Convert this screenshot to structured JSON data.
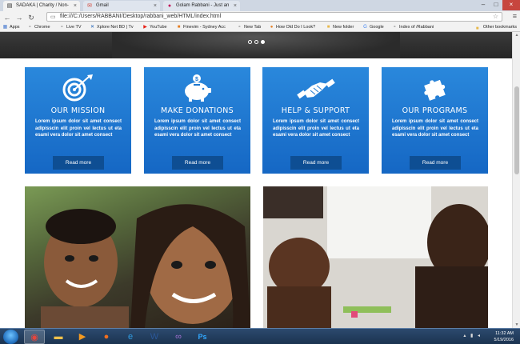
{
  "browser": {
    "tabs": [
      {
        "title": "SADAKA | Charity / Non-",
        "icon": "page-icon",
        "active": true
      },
      {
        "title": "Gmail",
        "icon": "gmail-icon",
        "active": false
      },
      {
        "title": "Golam Rabbani - Just an",
        "icon": "profile-icon",
        "active": false
      }
    ],
    "url": "file:///C:/Users/RABBANI/Desktop/rabbani_web/HTML/index.html",
    "bookmarks": [
      {
        "label": "Apps",
        "icon": "apps-icon"
      },
      {
        "label": "Chrome",
        "icon": "page-icon"
      },
      {
        "label": "Live TV",
        "icon": "page-icon"
      },
      {
        "label": "Xplore Net BD | Tv",
        "icon": "x-icon"
      },
      {
        "label": "YouTube",
        "icon": "youtube-icon"
      },
      {
        "label": "Finevim - Sydney Acc",
        "icon": "page-icon"
      },
      {
        "label": "New Tab",
        "icon": "page-icon"
      },
      {
        "label": "How Old Do I Look?",
        "icon": "page-icon"
      },
      {
        "label": "New folder",
        "icon": "folder-icon"
      },
      {
        "label": "Google",
        "icon": "google-icon"
      },
      {
        "label": "Index of /Rabbani",
        "icon": "page-icon"
      }
    ],
    "other_bookmarks": "Other bookmarks"
  },
  "page": {
    "slider_dots": 3,
    "active_dot": 2,
    "cards": [
      {
        "title": "OUR MISSION",
        "icon": "target-icon",
        "text": "Lorem ipsum dolor sit amet consect adipisscin elit proin vel lectus ut eta esami vera dolor sit amet consect",
        "button": "Read more"
      },
      {
        "title": "MAKE DONATIONS",
        "icon": "piggy-bank-icon",
        "text": "Lorem ipsum dolor sit amet consect adipisscin elit proin vel lectus ut eta esami vera dolor sit amet consect",
        "button": "Read more"
      },
      {
        "title": "HELP & SUPPORT",
        "icon": "handshake-icon",
        "text": "Lorem ipsum dolor sit amet consect adipisscin elit proin vel lectus ut eta esami vera dolor sit amet consect",
        "button": "Read more"
      },
      {
        "title": "OUR PROGRAMS",
        "icon": "puzzle-icon",
        "text": "Lorem ipsum dolor sit amet consect adipisscin elit proin vel lectus ut eta esami vera dolor sit amet consect",
        "button": "Read more"
      }
    ],
    "colors": {
      "card_blue": "#1f78d1",
      "button_blue": "#0e4e93"
    }
  },
  "taskbar": {
    "apps": [
      "chrome-icon",
      "explorer-folder-icon",
      "media-player-icon",
      "firefox-icon",
      "internet-explorer-icon",
      "word-icon",
      "visual-studio-icon",
      "photoshop-icon"
    ],
    "time": "11:32 AM",
    "date": "5/19/2016"
  }
}
